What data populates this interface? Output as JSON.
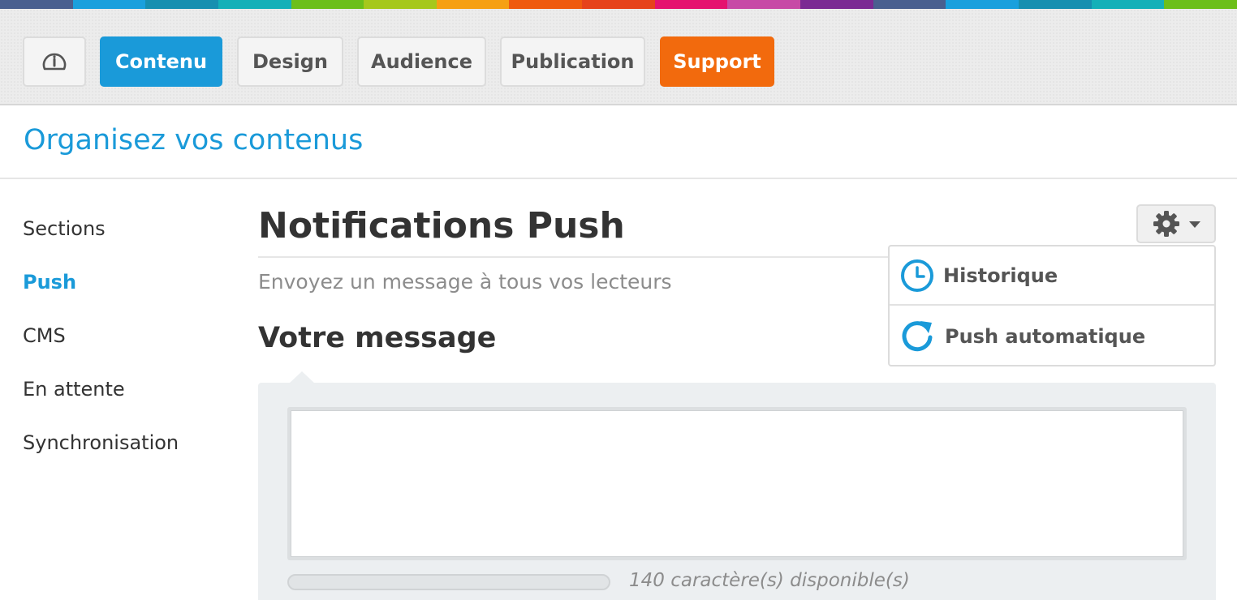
{
  "stripe_colors": [
    "#4a5f8f",
    "#1aa0dd",
    "#178fb0",
    "#14b0b8",
    "#6cbf1a",
    "#a6c81c",
    "#f6a013",
    "#ef5a0e",
    "#e6421b",
    "#e5126f",
    "#c74aa6",
    "#7b2a93",
    "#4a5f8f",
    "#1aa0dd",
    "#178fb0",
    "#14b0b8",
    "#6cbf1a"
  ],
  "colors": {
    "accent": "#1a9ad9",
    "support": "#f26a0d"
  },
  "nav": {
    "home_icon": "dashboard-gauge-icon",
    "contenu": "Contenu",
    "design": "Design",
    "audience": "Audience",
    "publication": "Publication",
    "support": "Support",
    "active": "Contenu"
  },
  "page": {
    "title": "Organisez vos contenus"
  },
  "sidebar": {
    "items": [
      {
        "label": "Sections",
        "active": false
      },
      {
        "label": "Push",
        "active": true
      },
      {
        "label": "CMS",
        "active": false
      },
      {
        "label": "En attente",
        "active": false
      },
      {
        "label": "Synchronisation",
        "active": false
      }
    ]
  },
  "main": {
    "heading": "Notifications Push",
    "subtitle": "Envoyez un message à tous vos lecteurs",
    "section_heading": "Votre message",
    "message_value": "",
    "chars_left": "140 caractère(s) disponible(s)",
    "progress_fraction": 0
  },
  "settings": {
    "gear_icon": "gear-icon",
    "caret_icon": "caret-down-icon",
    "menu": [
      {
        "label": "Historique",
        "icon": "clock-icon"
      },
      {
        "label": "Push automatique",
        "icon": "refresh-icon"
      }
    ]
  }
}
